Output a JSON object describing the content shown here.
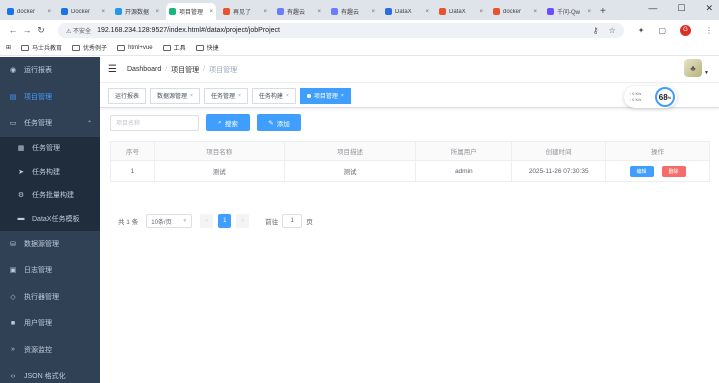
{
  "browser": {
    "tabs": [
      {
        "title": "docker",
        "color": "#1a73e8",
        "active": false
      },
      {
        "title": "Docker",
        "color": "#1a73e8",
        "active": false
      },
      {
        "title": "开源数据",
        "color": "#2496ed",
        "active": false
      },
      {
        "title": "项目管理",
        "color": "#1bb67c",
        "active": true
      },
      {
        "title": "再见了",
        "color": "#e8542f",
        "active": false
      },
      {
        "title": "有趣云",
        "color": "#6b7cff",
        "active": false
      },
      {
        "title": "有趣云",
        "color": "#6b7cff",
        "active": false
      },
      {
        "title": "DataX",
        "color": "#2a6fdb",
        "active": false
      },
      {
        "title": "DataX",
        "color": "#e8542f",
        "active": false
      },
      {
        "title": "docker",
        "color": "#e8542f",
        "active": false
      },
      {
        "title": "千问-Qw",
        "color": "#6b4cff",
        "active": false
      }
    ],
    "new_tab": "+",
    "security": "不安全",
    "url": "192.168.234.128:9527/index.html#/datax/project/jobProject",
    "bookmarks": [
      "马士兵教育",
      "优秀例子",
      "html+vue",
      "工具",
      "快捷"
    ],
    "profile_initial": "G"
  },
  "sidebar": {
    "items": [
      {
        "label": "运行报表",
        "icon": "dashboard-icon"
      },
      {
        "label": "项目管理",
        "icon": "project-icon",
        "active": true
      },
      {
        "label": "任务管理",
        "icon": "task-icon",
        "expanded": true
      },
      {
        "label": "数据源管理",
        "icon": "datasource-icon"
      },
      {
        "label": "日志管理",
        "icon": "log-icon"
      },
      {
        "label": "执行器管理",
        "icon": "executor-icon"
      },
      {
        "label": "用户管理",
        "icon": "user-icon"
      },
      {
        "label": "资源监控",
        "icon": "monitor-icon"
      },
      {
        "label": "JSON 格式化",
        "icon": "json-icon"
      }
    ],
    "submenu": [
      {
        "label": "任务管理",
        "icon": "list-icon"
      },
      {
        "label": "任务构建",
        "icon": "send-icon"
      },
      {
        "label": "任务批量构建",
        "icon": "batch-icon"
      },
      {
        "label": "DataX任务模板",
        "icon": "template-icon"
      }
    ]
  },
  "navbar": {
    "breadcrumb": [
      "Dashboard",
      "项目管理",
      "项目管理"
    ]
  },
  "tags": [
    {
      "label": "运行报表",
      "closable": false,
      "active": false
    },
    {
      "label": "数据源管理",
      "closable": true,
      "active": false
    },
    {
      "label": "任务管理",
      "closable": true,
      "active": false
    },
    {
      "label": "任务构建",
      "closable": true,
      "active": false
    },
    {
      "label": "项目管理",
      "closable": true,
      "active": true
    }
  ],
  "speed": {
    "up": "0 K/s",
    "down": "0 K/s",
    "percent": "68",
    "unit": "%"
  },
  "filter": {
    "placeholder": "项目名称",
    "search_label": "搜索",
    "add_label": "添加"
  },
  "table": {
    "columns": [
      "序号",
      "项目名称",
      "项目描述",
      "所属用户",
      "创建时间",
      "操作"
    ],
    "rows": [
      {
        "index": "1",
        "name": "测试",
        "desc": "测试",
        "user": "admin",
        "created": "2025-11-26 07:30:35"
      }
    ],
    "edit_label": "编辑",
    "delete_label": "删除"
  },
  "pagination": {
    "total": "共 1 条",
    "page_size": "10条/页",
    "current": "1",
    "goto_prefix": "前往",
    "goto_value": "1",
    "goto_suffix": "页"
  },
  "colors": {
    "sidebar_bg": "#304156",
    "accent": "#409eff",
    "danger": "#f56c6c"
  }
}
